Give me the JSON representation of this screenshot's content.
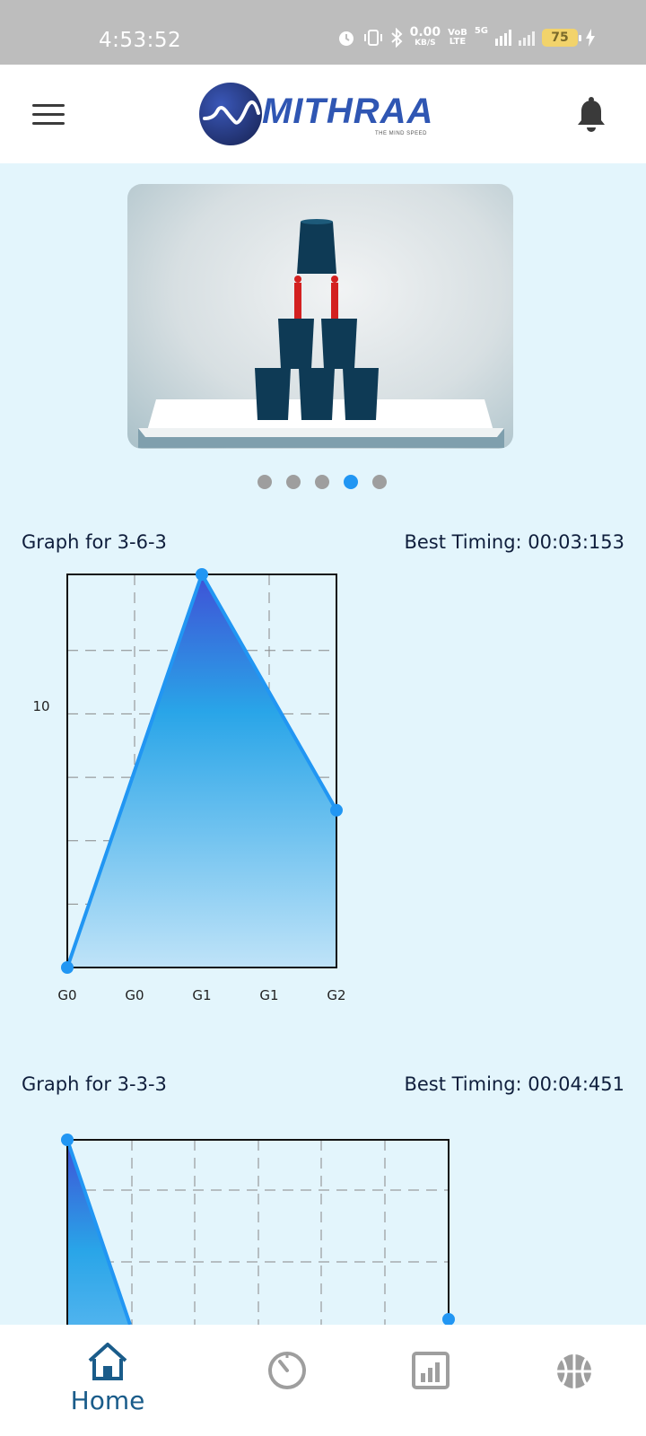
{
  "status": {
    "time": "4:53:52",
    "net_speed_top": "0.00",
    "net_speed_bottom": "KB/S",
    "volte_top": "VoB",
    "volte_bottom": "LTE",
    "network": "5G",
    "battery": "75"
  },
  "header": {
    "logo_text": "MITHRAA",
    "logo_tagline": "THE MIND SPEED",
    "menu_icon": "hamburger-menu-icon",
    "bell_icon": "bell-icon"
  },
  "carousel": {
    "slide_count": 5,
    "active_index": 3
  },
  "graphs": [
    {
      "title": "Graph for 3-6-3",
      "best": "Best Timing: 00:03:153",
      "chart_data": {
        "type": "area",
        "x": [
          "G0",
          "G0",
          "G1",
          "G1",
          "G2"
        ],
        "values": [
          0,
          null,
          15,
          null,
          6
        ],
        "y_tick_labels": [
          "10"
        ],
        "ylim": [
          0,
          15
        ],
        "grid": true,
        "color": "#2196f3",
        "title": "",
        "xlabel": "",
        "ylabel": ""
      }
    },
    {
      "title": "Graph for 3-3-3",
      "best": "Best Timing: 00:04:451",
      "chart_data": {
        "type": "area",
        "x": [],
        "values": [],
        "grid": true,
        "color": "#2196f3",
        "title": "",
        "xlabel": "",
        "ylabel": ""
      }
    }
  ],
  "bottom_nav": [
    {
      "label": "Home",
      "icon": "home-icon",
      "active": true
    },
    {
      "label": "",
      "icon": "timer-icon",
      "active": false
    },
    {
      "label": "",
      "icon": "stats-icon",
      "active": false
    },
    {
      "label": "",
      "icon": "basketball-icon",
      "active": false
    }
  ],
  "colors": {
    "accent": "#2196f3",
    "active_nav": "#1a5c8a",
    "background": "#e3f5fc"
  }
}
